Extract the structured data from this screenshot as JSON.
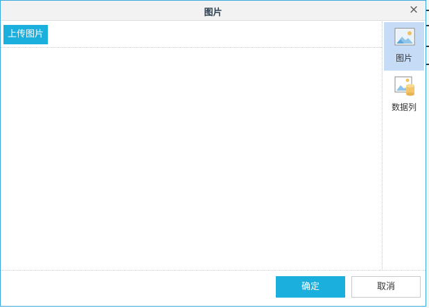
{
  "dialog": {
    "title": "图片",
    "close_icon": "close-icon",
    "close_glyph": "×"
  },
  "toolbar": {
    "upload_label": "上传图片"
  },
  "sidebar": {
    "items": [
      {
        "label": "图片",
        "icon": "image-icon",
        "active": true
      },
      {
        "label": "数据列",
        "icon": "image-data-column-icon",
        "active": false
      }
    ]
  },
  "footer": {
    "ok_label": "确定",
    "cancel_label": "取消"
  },
  "colors": {
    "accent": "#1aafdd",
    "active_bg": "#c6dcf6",
    "border": "#39a7e0"
  }
}
